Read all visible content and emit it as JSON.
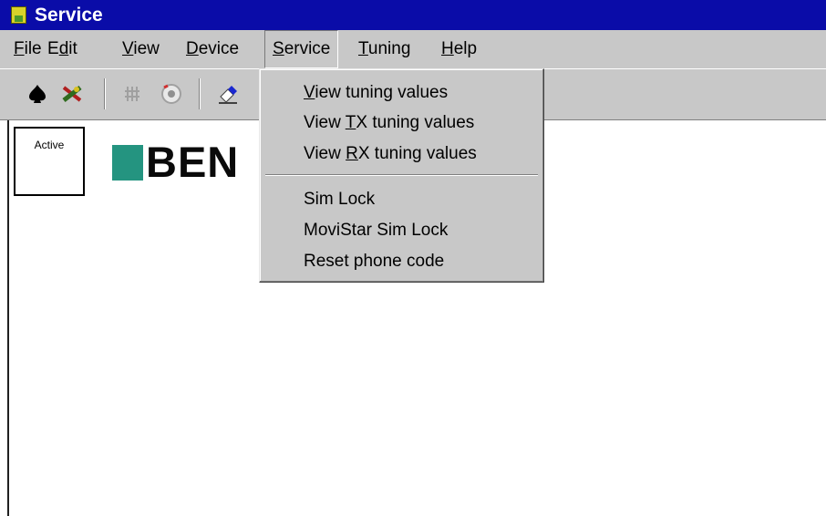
{
  "window": {
    "title": "Service"
  },
  "menu": {
    "file": {
      "pre": "",
      "key": "F",
      "post": "ile"
    },
    "edit": {
      "pre": "E",
      "key": "d",
      "post": "it"
    },
    "view": {
      "pre": "",
      "key": "V",
      "post": "iew"
    },
    "device": {
      "pre": "",
      "key": "D",
      "post": "evice"
    },
    "service": {
      "pre": "",
      "key": "S",
      "post": "ervice"
    },
    "tuning": {
      "pre": "",
      "key": "T",
      "post": "uning"
    },
    "help": {
      "pre": "",
      "key": "H",
      "post": "elp"
    }
  },
  "toolbar": {
    "icons": [
      "spade-icon",
      "plug-cross-icon",
      "grid-icon",
      "circle-target-icon",
      "eraser-icon"
    ]
  },
  "status_box": {
    "label": "Active"
  },
  "logo": {
    "text": "BEN",
    "color": "#249480"
  },
  "service_menu": {
    "items": [
      {
        "pre": "",
        "key": "V",
        "post": "iew tuning values"
      },
      {
        "pre": "View ",
        "key": "T",
        "post": "X tuning values"
      },
      {
        "pre": "View ",
        "key": "R",
        "post": "X tuning values"
      },
      {
        "pre": "",
        "key": "",
        "post": "Sim Lock"
      },
      {
        "pre": "",
        "key": "",
        "post": "MoviStar Sim Lock"
      },
      {
        "pre": "",
        "key": "",
        "post": "Reset phone code"
      }
    ]
  },
  "colors": {
    "titlebar": "#0a0ca8",
    "face": "#c8c8c8"
  }
}
